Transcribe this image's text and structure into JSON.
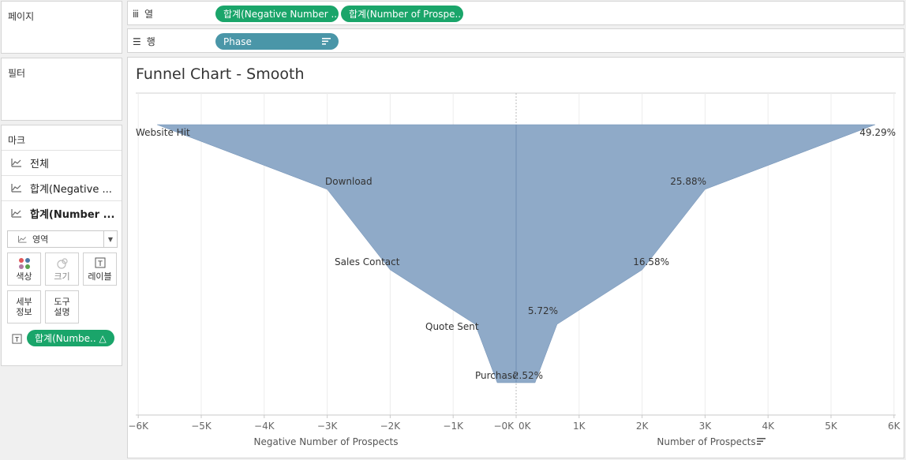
{
  "panels": {
    "pages": "페이지",
    "filters": "필터",
    "marks": "마크"
  },
  "marks": {
    "rows": [
      "전체",
      "합계(Negative ...",
      "합계(Number ..."
    ],
    "mark_type": "영역",
    "buttons": {
      "color": "색상",
      "size": "크기",
      "label": "레이블",
      "detail_line1": "세부",
      "detail_line2": "정보",
      "tooltip_line1": "도구",
      "tooltip_line2": "설명"
    },
    "label_pill": "합계(Numbe.. △"
  },
  "shelves": {
    "columns_label": "열",
    "columns_pills": [
      "합계(Negative Number ..",
      "합계(Number of Prospe.."
    ],
    "rows_label": "행",
    "rows_pill": "Phase"
  },
  "viz": {
    "title": "Funnel Chart - Smooth"
  },
  "colors": {
    "area_fill": "#8faac8",
    "pill_green": "#1aa56a",
    "pill_teal": "#4a96a8"
  },
  "chart_data": {
    "type": "area",
    "title": "Funnel Chart - Smooth",
    "categories": [
      "Website Hit",
      "Download",
      "Sales Contact",
      "Quote Sent",
      "Purchase"
    ],
    "series": [
      {
        "name": "Negative Number of Prospects",
        "values": [
          -5700,
          -3000,
          -2000,
          -650,
          -300
        ]
      },
      {
        "name": "Number of Prospects",
        "values": [
          5700,
          3000,
          2000,
          650,
          300
        ]
      }
    ],
    "percent_labels": [
      "49.29%",
      "25.88%",
      "16.58%",
      "5.72%",
      "2.52%"
    ],
    "left_axis": {
      "label": "Negative Number of Prospects",
      "range": [
        -6000,
        0
      ],
      "ticks": [
        -6000,
        -5000,
        -4000,
        -3000,
        -2000,
        -1000,
        0
      ],
      "tick_labels": [
        "−6K",
        "−5K",
        "−4K",
        "−3K",
        "−2K",
        "−1K",
        "−0K"
      ]
    },
    "right_axis": {
      "label": "Number of Prospects",
      "range": [
        0,
        6000
      ],
      "ticks": [
        0,
        1000,
        2000,
        3000,
        4000,
        5000,
        6000
      ],
      "tick_labels": [
        "0K",
        "1K",
        "2K",
        "3K",
        "4K",
        "5K",
        "6K"
      ]
    },
    "grid": true
  }
}
